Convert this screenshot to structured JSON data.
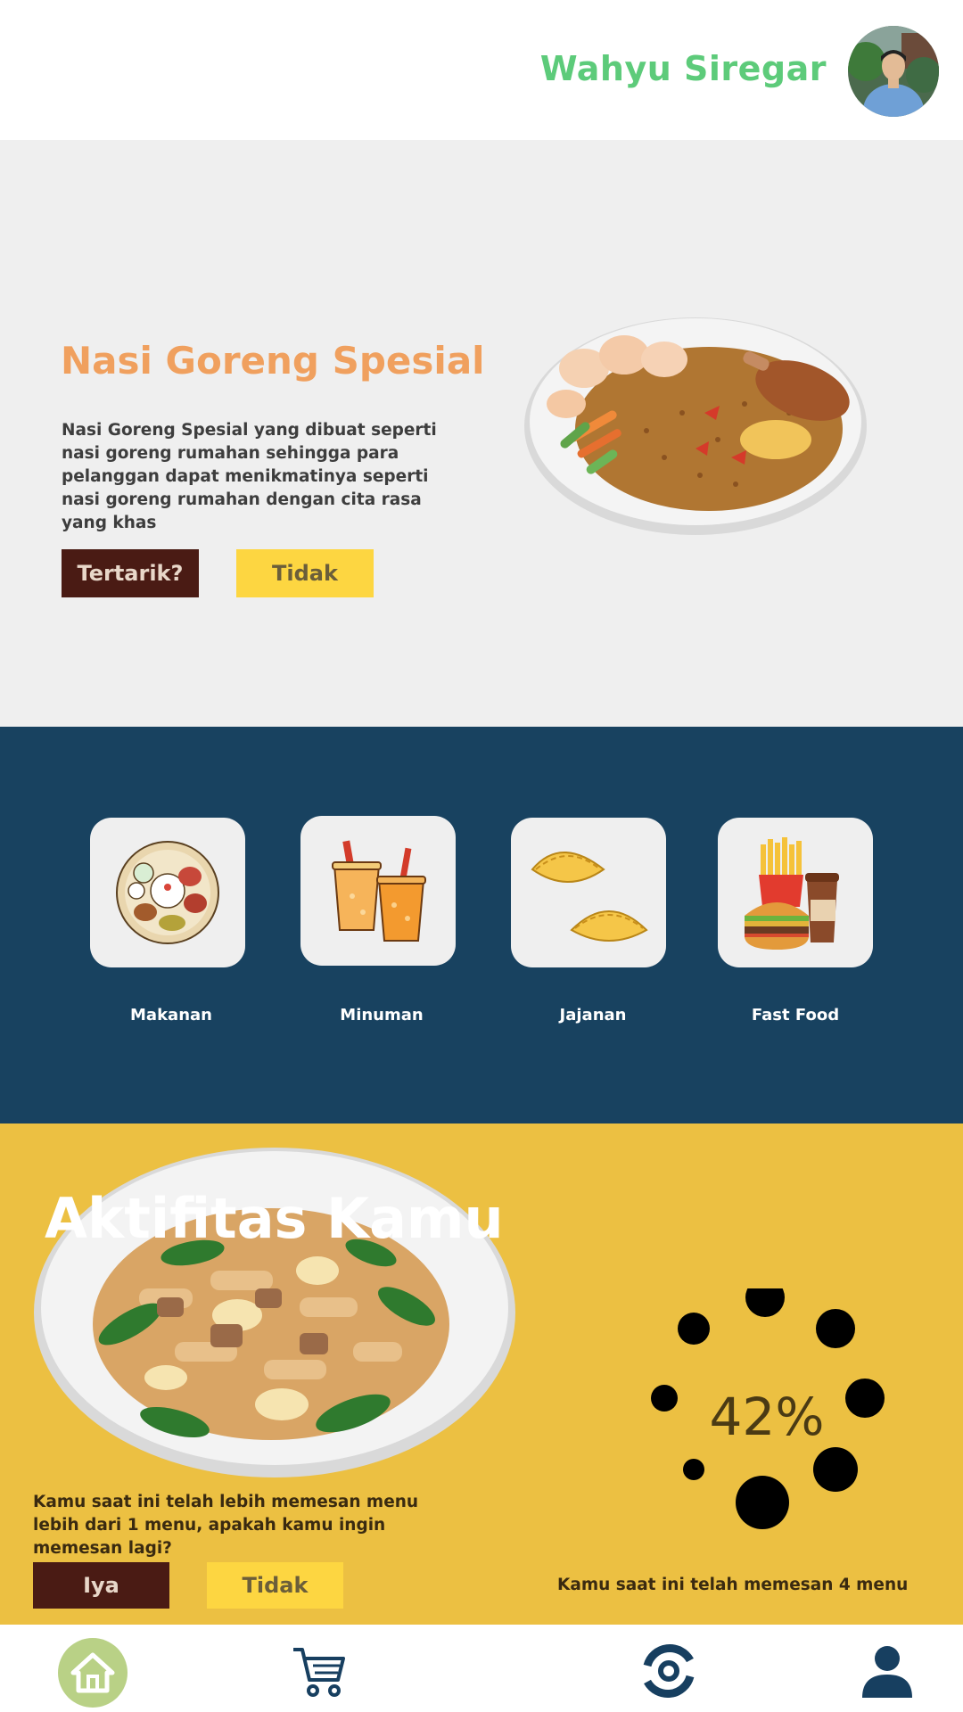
{
  "header": {
    "username": "Wahyu Siregar",
    "avatar_icon": "user-avatar-photo"
  },
  "hero": {
    "title": "Nasi Goreng Spesial",
    "description": "Nasi Goreng Spesial yang dibuat seperti nasi goreng rumahan sehingga para pelanggan dapat menikmatinya seperti nasi goreng rumahan dengan cita rasa yang khas",
    "accept_label": "Tertarik?",
    "decline_label": "Tidak",
    "image_icon": "fried-rice-plate-image"
  },
  "categories": {
    "items": [
      {
        "label": "Makanan",
        "icon": "food-plate-icon"
      },
      {
        "label": "Minuman",
        "icon": "drinks-icon"
      },
      {
        "label": "Jajanan",
        "icon": "snack-pastry-icon"
      },
      {
        "label": "Fast Food",
        "icon": "fast-food-icon"
      }
    ]
  },
  "activity": {
    "title": "Aktifitas Kamu",
    "description": "Kamu saat ini telah lebih memesan menu lebih dari 1 menu, apakah kamu ingin memesan lagi?",
    "yes_label": "Iya",
    "no_label": "Tidak",
    "progress_label": "42%",
    "progress_value": 0.42,
    "status": "Kamu saat ini telah memesan 4 menu",
    "image_icon": "noodle-plate-image"
  },
  "nav": {
    "items": [
      {
        "icon": "home-icon",
        "active": true
      },
      {
        "icon": "cart-icon",
        "active": false
      },
      {
        "icon": "orders-icon",
        "active": false
      },
      {
        "icon": "profile-icon",
        "active": false
      }
    ]
  },
  "colors": {
    "brand_green": "#5dcb7a",
    "accent_orange": "#f0a05e",
    "dark_button": "#4a1b14",
    "yellow_button": "#fdd641",
    "navy": "#184260",
    "activity_yellow": "#ecc042"
  }
}
